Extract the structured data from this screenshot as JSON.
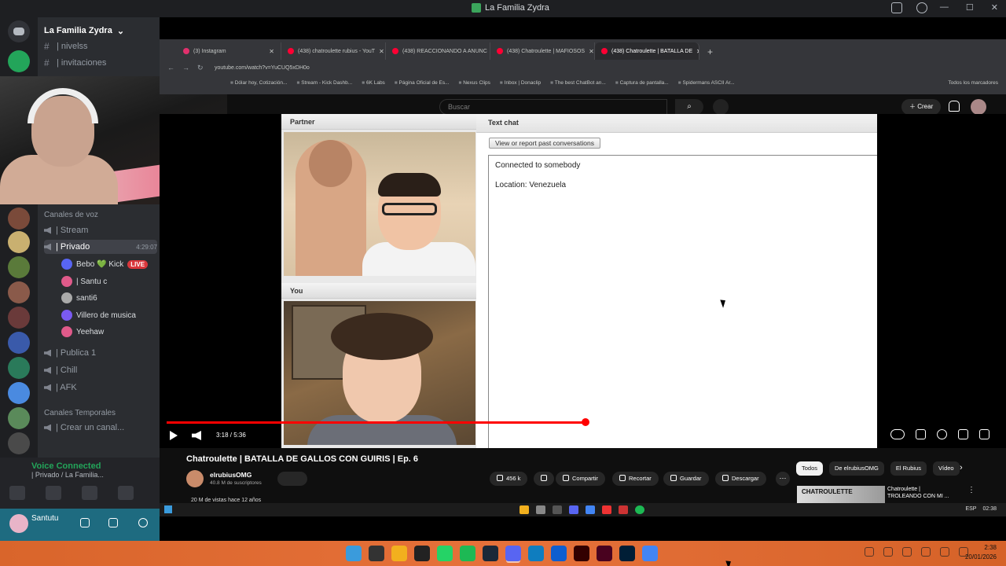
{
  "outer_window": {
    "title": "La Familia Zydra"
  },
  "discord": {
    "server_name": "La Familia Zydra",
    "channels": [
      {
        "name": "| nivelss",
        "type": "text"
      },
      {
        "name": "| invitaciones",
        "type": "text"
      },
      {
        "name": "Canales de voz",
        "type": "category"
      },
      {
        "name": "| Stream",
        "type": "voice"
      },
      {
        "name": "| Privado",
        "type": "voice",
        "active": true,
        "time": "4:29:07"
      },
      {
        "name": "| Publica 1",
        "type": "voice"
      },
      {
        "name": "| Chill",
        "type": "voice"
      },
      {
        "name": "| AFK",
        "type": "voice"
      },
      {
        "name": "Canales Temporales",
        "type": "category"
      },
      {
        "name": "| Crear un canal...",
        "type": "voice"
      }
    ],
    "voice_users": [
      {
        "name": "Bebo 💚 Kick",
        "badge": "LIVE"
      },
      {
        "name": "| Santu c"
      },
      {
        "name": "santi6"
      },
      {
        "name": "Villero de musica"
      },
      {
        "name": "Yeehaw"
      }
    ],
    "voice_status": {
      "title": "Voice Connected",
      "subtitle": "| Privado / La Familia..."
    },
    "user": {
      "name": "Santutu"
    }
  },
  "browser": {
    "tabs": [
      {
        "label": "(3) Instagram",
        "color": "#e1306c"
      },
      {
        "label": "(438) chatroulette rubius - YouT",
        "color": "#ff0033"
      },
      {
        "label": "(438) REACCIONANDO A ANUNC",
        "color": "#ff0033"
      },
      {
        "label": "(438) Chatroulette | MAFIOSOS",
        "color": "#ff0033"
      },
      {
        "label": "(438) Chatroulette | BATALLA DE",
        "color": "#ff0033",
        "active": true
      }
    ],
    "url": "youtube.com/watch?v=YuCUQ5xDH0o",
    "bookmarks": [
      "Dólar hoy, Cotización...",
      "Stream - Kick Dashb...",
      "6K Labs",
      "Página Oficial de Es...",
      "Nexus Clips",
      "Inbox | Donaclip",
      "The best ChatBot an...",
      "Captura de pantalla...",
      "Spidermans ASCII Ar..."
    ],
    "bookmarks_all": "Todos los marcadores"
  },
  "youtube": {
    "search_placeholder": "Buscar",
    "create_label": "Crear",
    "notif_count": "9+",
    "video": {
      "time": "3:18 / 5:36",
      "progress": 0.59,
      "title": "Chatroulette | BATALLA DE GALLOS CON GUIRIS | Ep. 6",
      "channel": "elrubiusOMG",
      "subscribers": "40.8 M de suscriptores",
      "views": "20 M de vistas  hace 12 años",
      "likes": "456 k",
      "actions": {
        "share": "Compartir",
        "clip": "Recortar",
        "save": "Guardar",
        "download": "Descargar"
      }
    },
    "chips": [
      "Todos",
      "De elrubiusOMG",
      "El Rubius",
      "Vídeo"
    ],
    "recommendation": {
      "thumb_text": "CHATROULETTE",
      "title_line1": "Chatroulette |",
      "title_line2": "TROLEANDO CON MI ..."
    }
  },
  "chatroulette": {
    "partner_label": "Partner",
    "you_label": "You",
    "text_chat_label": "Text chat",
    "report_button": "View or report past conversations",
    "messages": [
      "Connected to somebody",
      "Location: Venezuela"
    ]
  },
  "inner_taskbar": {
    "lang": "ESP",
    "time": "02:38"
  },
  "taskbar": {
    "time": "2:38",
    "date": "20/01/2026",
    "apps": [
      {
        "name": "start-icon",
        "color": "#3a9bdc"
      },
      {
        "name": "search-icon",
        "color": "#333"
      },
      {
        "name": "file-explorer-icon",
        "color": "#f2b01e"
      },
      {
        "name": "capcut-icon",
        "color": "#222"
      },
      {
        "name": "whatsapp-icon",
        "color": "#25d366"
      },
      {
        "name": "spotify-icon",
        "color": "#1db954"
      },
      {
        "name": "steam-icon",
        "color": "#1b2838"
      },
      {
        "name": "discord-icon",
        "color": "#5865f2"
      },
      {
        "name": "edge-icon",
        "color": "#0f7dbf"
      },
      {
        "name": "teamviewer-icon",
        "color": "#0e5ecf"
      },
      {
        "name": "illustrator-icon",
        "color": "#330000"
      },
      {
        "name": "indesign-icon",
        "color": "#49021f"
      },
      {
        "name": "photoshop-icon",
        "color": "#001e36"
      },
      {
        "name": "chrome-icon",
        "color": "#4285f4"
      }
    ]
  }
}
